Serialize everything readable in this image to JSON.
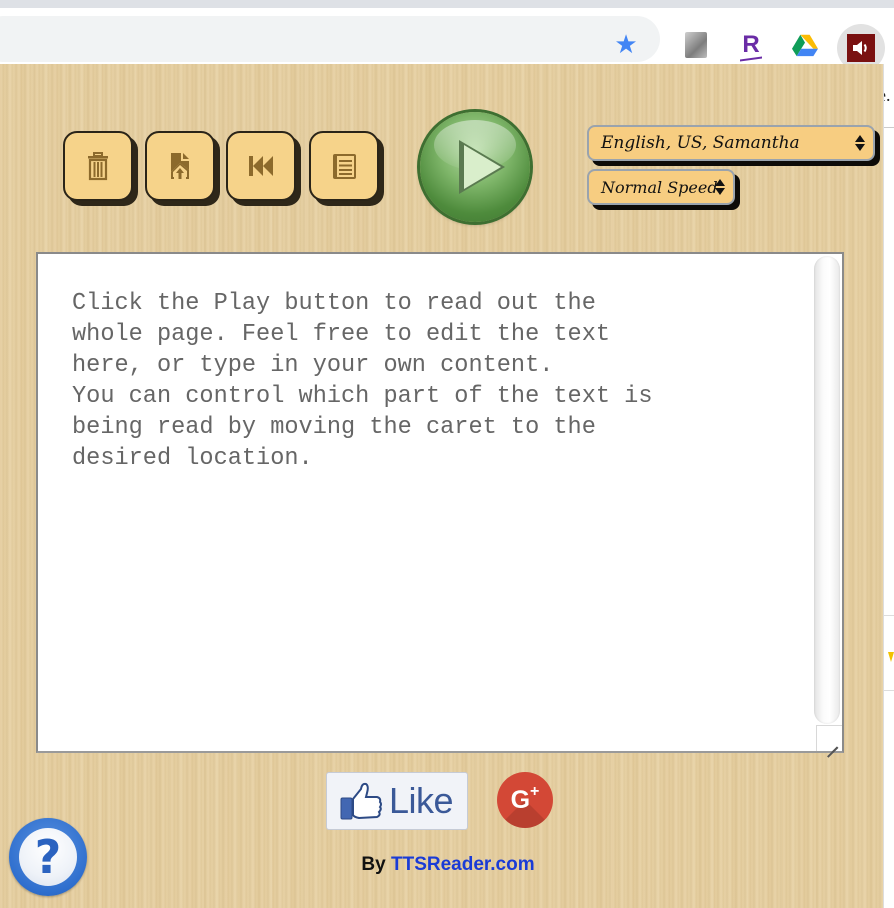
{
  "browser": {
    "extensions": [
      {
        "name": "image-extension",
        "icon": "photo-thumbnail-icon"
      },
      {
        "name": "rakuten-extension",
        "icon": "r-logo-icon",
        "glyph": "R"
      },
      {
        "name": "google-drive-extension",
        "icon": "google-drive-icon"
      },
      {
        "name": "tts-reader-extension",
        "icon": "speaker-icon",
        "active": true
      }
    ],
    "bookmark_icon": "star-icon",
    "background_page_text": "e."
  },
  "toolbar": {
    "buttons": [
      {
        "id": "clear",
        "icon": "trash-icon"
      },
      {
        "id": "upload",
        "icon": "file-upload-icon"
      },
      {
        "id": "rewind",
        "icon": "skip-back-icon"
      },
      {
        "id": "reader",
        "icon": "reader-mode-icon"
      }
    ],
    "play_icon": "play-icon",
    "colors": {
      "button_fill": "#f6d38a",
      "icon": "#8c6a2c",
      "play_green": "#4e8b3c"
    }
  },
  "voice_select": {
    "selected": "English, US, Samantha"
  },
  "speed_select": {
    "selected": "Normal Speed"
  },
  "editor": {
    "text": "Click the Play button to read out the\nwhole page. Feel free to edit the text\nhere, or type in your own content.\nYou can control which part of the text is\nbeing read by moving the caret to the\ndesired location."
  },
  "social": {
    "like_label": "Like",
    "gplus_label": "G",
    "gplus_plus": "+"
  },
  "footer": {
    "by_prefix": "By ",
    "link_text": "TTSReader.com"
  },
  "help": {
    "glyph": "?"
  }
}
